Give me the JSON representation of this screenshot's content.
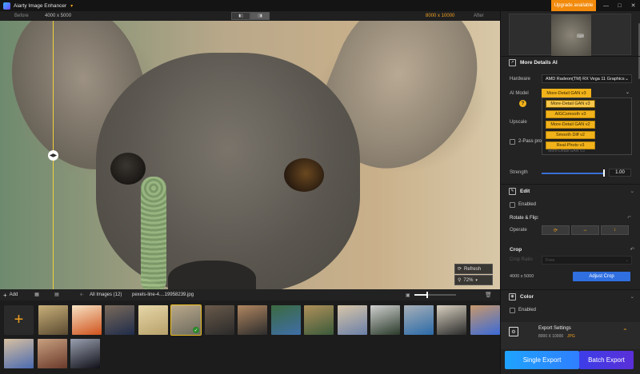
{
  "app": {
    "title": "Aiarty Image Enhancer",
    "upgrade_label": "Upgrade available"
  },
  "compare": {
    "before_label": "Before",
    "after_label": "After",
    "size_before": "4000 x 5000",
    "size_after": "8000 x 10000"
  },
  "canvas": {
    "refresh_label": "Refresh",
    "zoom_value": "72%"
  },
  "bottombar": {
    "add_label": "Add",
    "all_images_label": "All Images (12)",
    "current_file": "pexels-line-4....19958239.jpg",
    "thumb_slider_fraction": 0.3
  },
  "thumbnails": [
    {
      "c1": "#5a4a30",
      "c2": "#c9b07a"
    },
    {
      "c1": "#d0521c",
      "c2": "#f6e3c4"
    },
    {
      "c1": "#1f2c4a",
      "c2": "#7a6a5a"
    },
    {
      "c1": "#b7a16a",
      "c2": "#e6d6a8"
    },
    {
      "c1": "#6c6a5e",
      "c2": "#b9a88a",
      "selected": true
    },
    {
      "c1": "#2a2a2a",
      "c2": "#6a5a4a"
    },
    {
      "c1": "#2c2c2c",
      "c2": "#b08660"
    },
    {
      "c1": "#3e6ea8",
      "c2": "#3c6a40"
    },
    {
      "c1": "#3a5a3a",
      "c2": "#b0905a"
    },
    {
      "c1": "#6a7fa8",
      "c2": "#d8c6a8"
    },
    {
      "c1": "#2a3a2a",
      "c2": "#d0d0d0"
    },
    {
      "c1": "#2a6aa8",
      "c2": "#a8b0b8"
    },
    {
      "c1": "#2a2a2a",
      "c2": "#d8d0c0"
    },
    {
      "c1": "#3a6ad8",
      "c2": "#c8986a"
    },
    {
      "c1": "#4a6ab0",
      "c2": "#d8c0a0"
    },
    {
      "c1": "#6a3a2a",
      "c2": "#c8a080"
    },
    {
      "c1": "#101018",
      "c2": "#9aa0b0"
    }
  ],
  "panel": {
    "more_details_title": "More Details AI",
    "hardware_label": "Hardware",
    "hardware_value": "AMD Radeon(TM) RX Vega 11 Graphics",
    "ai_model_label": "AI Model",
    "ai_model_value": "More-Detail GAN  v3",
    "ai_model_options": [
      "More-Detail GAN  v3",
      "AIGCsmooth  v3",
      "More-Detail GAN  v2",
      "Smooth Diff  v2",
      "Real-Photo  v3"
    ],
    "ai_model_ghost": "More-Detail GAN  V3",
    "upscale_label": "Upscale",
    "two_pass_label": "2-Pass pro",
    "strength_label": "Strength",
    "strength_value": "1.00",
    "strength_fraction": 1.0,
    "edit_title": "Edit",
    "edit_enabled_label": "Enabled",
    "rotate_flip_label": "Rotate & Flip:",
    "operate_label": "Operate",
    "crop_title": "Crop",
    "crop_ratio_label": "Crop Ratio",
    "crop_ratio_value": "Free",
    "crop_dims": "4000 x 5000",
    "adjust_crop_label": "Adjust Crop",
    "color_title": "Color",
    "color_enabled_label": "Enabled",
    "export_settings_title": "Export Settings",
    "export_settings_size": "8000 X 10000",
    "export_settings_format": "JPG",
    "single_export_label": "Single Export",
    "batch_export_label": "Batch Export"
  },
  "colors": {
    "accent_orange": "#f2b21a",
    "accent_blue": "#2f6fe0",
    "split_line": "#f2d23a"
  },
  "icons": [
    "app-logo-icon",
    "chevron-down-icon",
    "minimize-icon",
    "maximize-icon",
    "close-icon",
    "split-view-icon",
    "side-by-side-icon",
    "compare-handle-icon",
    "refresh-icon",
    "zoom-icon",
    "add-icon",
    "grid-view-icon",
    "list-view-icon",
    "back-arrow-icon",
    "image-size-icon",
    "trash-icon",
    "more-details-icon",
    "help-icon",
    "edit-icon",
    "rotate-icon",
    "flip-horizontal-icon",
    "flip-vertical-icon",
    "crop-icon",
    "reset-icon",
    "color-icon",
    "export-settings-icon",
    "expand-up-icon"
  ]
}
